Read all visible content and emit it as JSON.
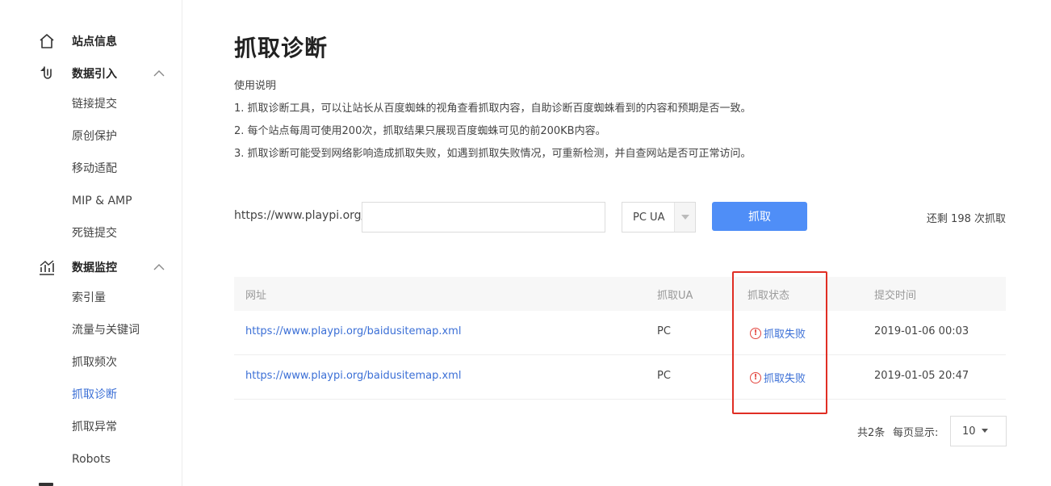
{
  "sidebar": {
    "group_site": {
      "label": "站点信息",
      "icon": "home-icon"
    },
    "group_data_in": {
      "label": "数据引入",
      "icon": "data-import-icon",
      "expanded": true
    },
    "data_in_items": [
      "链接提交",
      "原创保护",
      "移动适配",
      "MIP & AMP",
      "死链提交"
    ],
    "group_monitor": {
      "label": "数据监控",
      "icon": "chart-icon",
      "expanded": true
    },
    "monitor_items": [
      "索引量",
      "流量与关键词",
      "抓取频次",
      "抓取诊断",
      "抓取异常",
      "Robots"
    ],
    "active_item": "抓取诊断"
  },
  "main": {
    "title": "抓取诊断",
    "usage_title": "使用说明",
    "usage_lines": [
      "1. 抓取诊断工具，可以让站长从百度蜘蛛的视角查看抓取内容，自助诊断百度蜘蛛看到的内容和预期是否一致。",
      "2. 每个站点每周可使用200次，抓取结果只展现百度蜘蛛可见的前200KB内容。",
      "3. 抓取诊断可能受到网络影响造成抓取失败，如遇到抓取失败情况，可重新检测，并自查网站是否可正常访问。"
    ],
    "form": {
      "prefix": "https://www.playpi.org/",
      "input_value": "",
      "ua_selected": "PC UA",
      "fetch_label": "抓取",
      "remaining": "还剩 198 次抓取"
    },
    "table": {
      "headers": [
        "网址",
        "抓取UA",
        "抓取状态",
        "提交时间"
      ],
      "rows": [
        {
          "url": "https://www.playpi.org/baidusitemap.xml",
          "ua": "PC",
          "status": "抓取失败",
          "time": "2019-01-06 00:03"
        },
        {
          "url": "https://www.playpi.org/baidusitemap.xml",
          "ua": "PC",
          "status": "抓取失败",
          "time": "2019-01-05 20:47"
        }
      ]
    },
    "pagination": {
      "total": "共2条",
      "per_page_label": "每页显示:",
      "page_size": "10"
    }
  },
  "colors": {
    "accent": "#4f8ef7",
    "link": "#3b6fd6",
    "error": "#e3463f",
    "highlight": "#e02e24"
  }
}
